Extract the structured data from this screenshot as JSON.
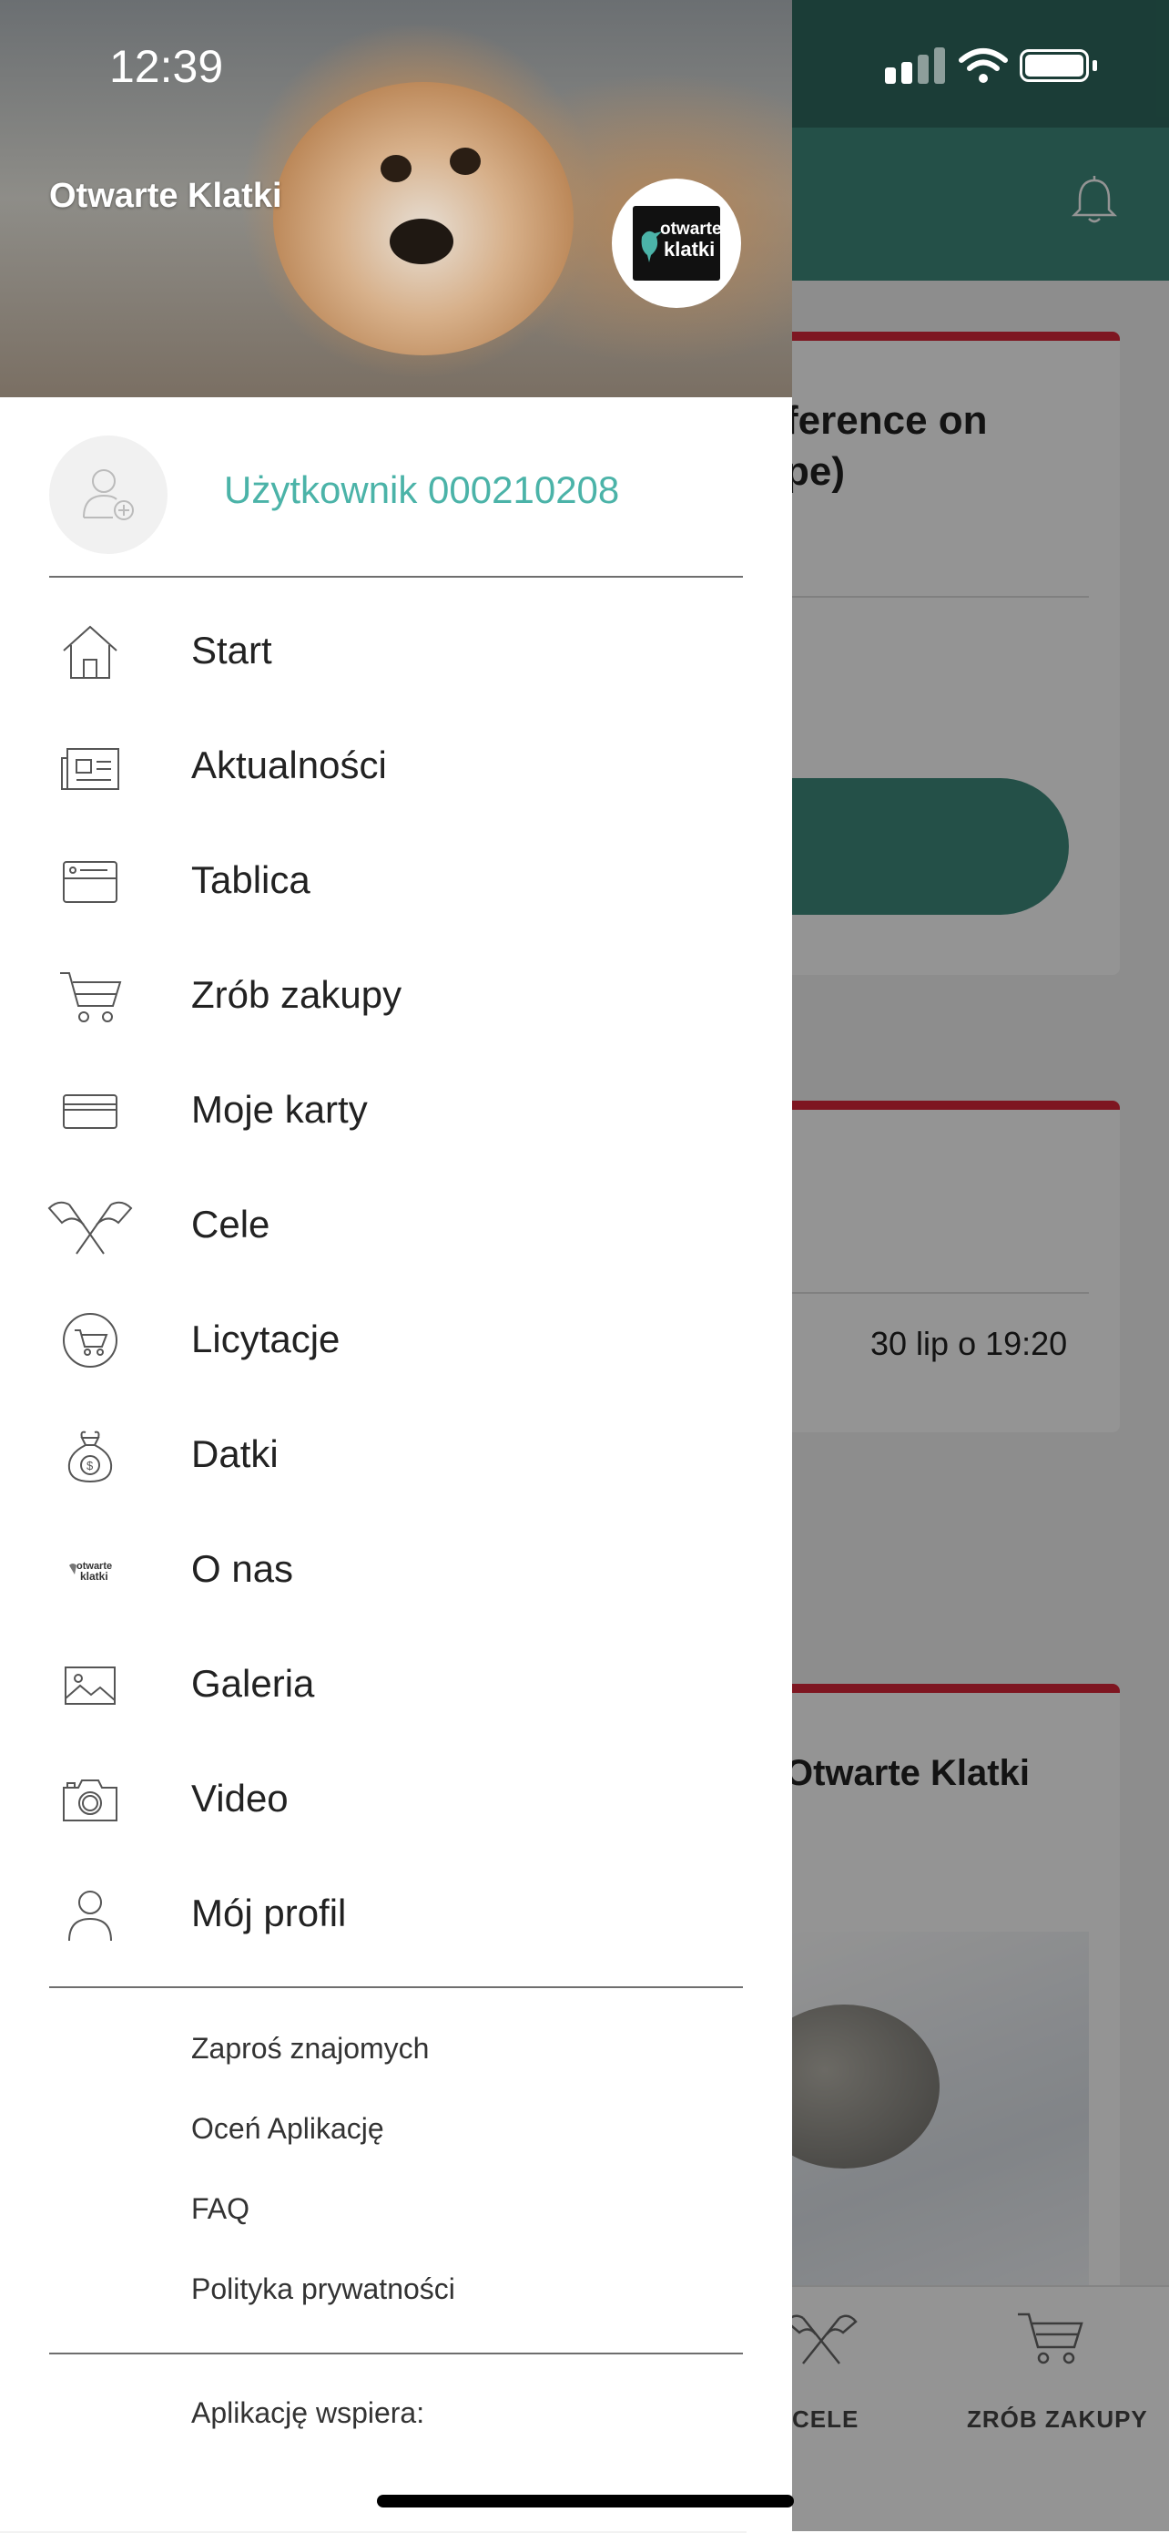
{
  "status_bar": {
    "time": "12:39"
  },
  "drawer": {
    "header_title": "Otwarte Klatki",
    "logo_text_line1": "otwarte",
    "logo_text_line2": "klatki",
    "user_name": "Użytkownik 000210208",
    "menu_items": [
      {
        "label": "Start",
        "icon": "home-icon"
      },
      {
        "label": "Aktualności",
        "icon": "newspaper-icon"
      },
      {
        "label": "Tablica",
        "icon": "board-icon"
      },
      {
        "label": "Zrób zakupy",
        "icon": "cart-icon"
      },
      {
        "label": "Moje karty",
        "icon": "card-icon"
      },
      {
        "label": "Cele",
        "icon": "flags-icon"
      },
      {
        "label": "Licytacje",
        "icon": "auction-cart-icon"
      },
      {
        "label": "Datki",
        "icon": "money-bag-icon"
      },
      {
        "label": "O nas",
        "icon": "otwarte-klatki-logo-icon"
      },
      {
        "label": "Galeria",
        "icon": "image-icon"
      },
      {
        "label": "Video",
        "icon": "camera-icon"
      },
      {
        "label": "Mój profil",
        "icon": "user-icon"
      }
    ],
    "sub_links": [
      "Zaproś znajomych",
      "Oceń Aplikację",
      "FAQ",
      "Polityka prywatności"
    ],
    "supported_by": "Aplikację wspiera:"
  },
  "background": {
    "card1_title_line1": "ference on",
    "card1_title_line2": "pe)",
    "card2_date": "30 lip o 19:20",
    "card3_title": "Otwarte Klatki",
    "tabs": [
      {
        "label": "CELE",
        "icon": "flags-icon"
      },
      {
        "label": "ZRÓB ZAKUPY",
        "icon": "cart-icon"
      }
    ]
  },
  "colors": {
    "accent_green": "#3f8a7d",
    "user_name_teal": "#4bb3a8",
    "card_top_red": "#d9273a"
  }
}
